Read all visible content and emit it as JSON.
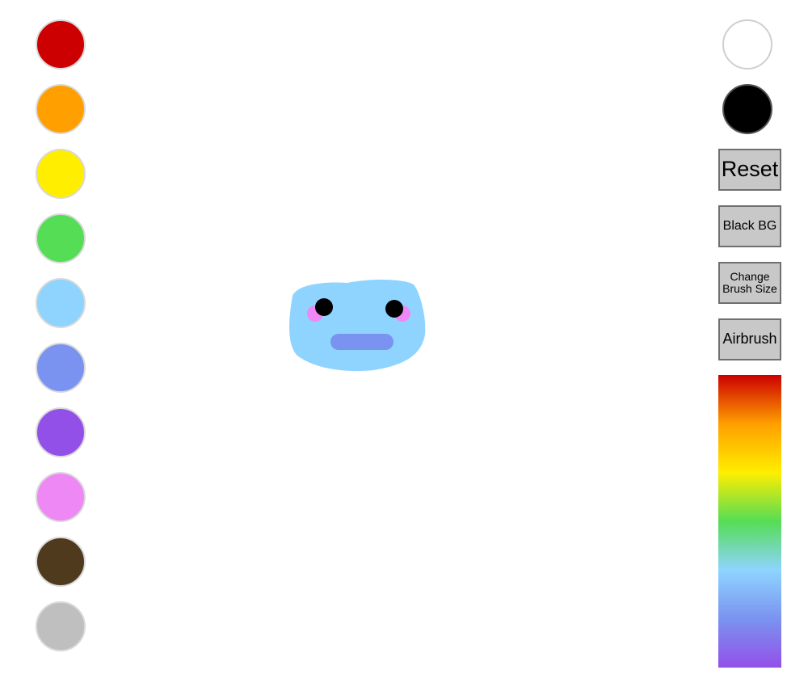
{
  "left_palette": {
    "colors": [
      {
        "name": "red",
        "hex": "#cc0000"
      },
      {
        "name": "orange",
        "hex": "#ff9f00"
      },
      {
        "name": "yellow",
        "hex": "#ffee00"
      },
      {
        "name": "green",
        "hex": "#55dd55"
      },
      {
        "name": "light-blue",
        "hex": "#8fd4ff"
      },
      {
        "name": "periwinkle",
        "hex": "#7a93f0"
      },
      {
        "name": "purple",
        "hex": "#9350e8"
      },
      {
        "name": "pink",
        "hex": "#ee88f5"
      },
      {
        "name": "brown",
        "hex": "#4f3a1d"
      },
      {
        "name": "gray",
        "hex": "#bfbfbf"
      }
    ]
  },
  "right_panel": {
    "white_swatch": "#ffffff",
    "black_swatch": "#000000",
    "buttons": {
      "reset": "Reset",
      "black_bg": "Black BG",
      "change_brush_size": "Change Brush Size",
      "airbrush": "Airbrush"
    },
    "rainbow_gradient_stops": [
      "#cc0000",
      "#ff9f00",
      "#ffee00",
      "#55dd55",
      "#8fd4ff",
      "#7a93f0",
      "#9350e8"
    ]
  },
  "drawing": {
    "face_color": "#8fd4ff",
    "eye_color": "#000000",
    "cheek_color": "#ee88f5",
    "mouth_color": "#7a93f0"
  }
}
